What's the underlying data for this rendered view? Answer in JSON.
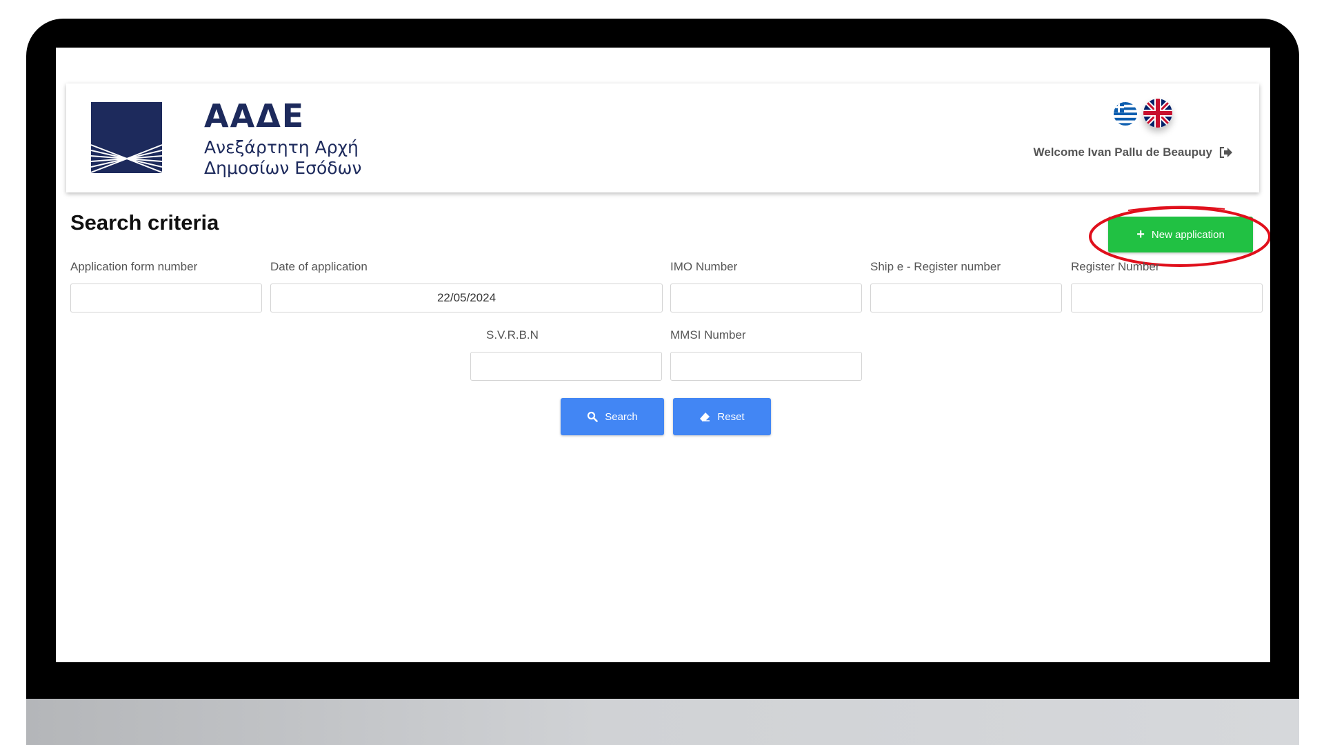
{
  "header": {
    "logo_abbr": "ΑΑΔΕ",
    "logo_line1": "Ανεξάρτητη Αρχή",
    "logo_line2": "Δημοσίων Εσόδων",
    "welcome_text": "Welcome Ivan Pallu de Beaupuy",
    "languages": [
      "greek-flag-icon",
      "uk-flag-icon"
    ]
  },
  "search": {
    "title": "Search criteria",
    "new_application_label": "New application",
    "fields": {
      "application_form_number": {
        "label": "Application form number",
        "value": ""
      },
      "date_of_application": {
        "label": "Date of application",
        "value": "22/05/2024"
      },
      "imo_number": {
        "label": "IMO Number",
        "value": ""
      },
      "ship_e_register_number": {
        "label": "Ship e - Register number",
        "value": ""
      },
      "register_number": {
        "label": "Register Number",
        "value": ""
      },
      "svrbn": {
        "label": "S.V.R.B.N",
        "value": ""
      },
      "mmsi_number": {
        "label": "MMSI Number",
        "value": ""
      }
    },
    "search_label": "Search",
    "reset_label": "Reset"
  },
  "colors": {
    "brand_navy": "#1d2a5c",
    "new_app_green": "#21c143",
    "action_blue": "#4286f4",
    "highlight_red": "#e0101c"
  }
}
